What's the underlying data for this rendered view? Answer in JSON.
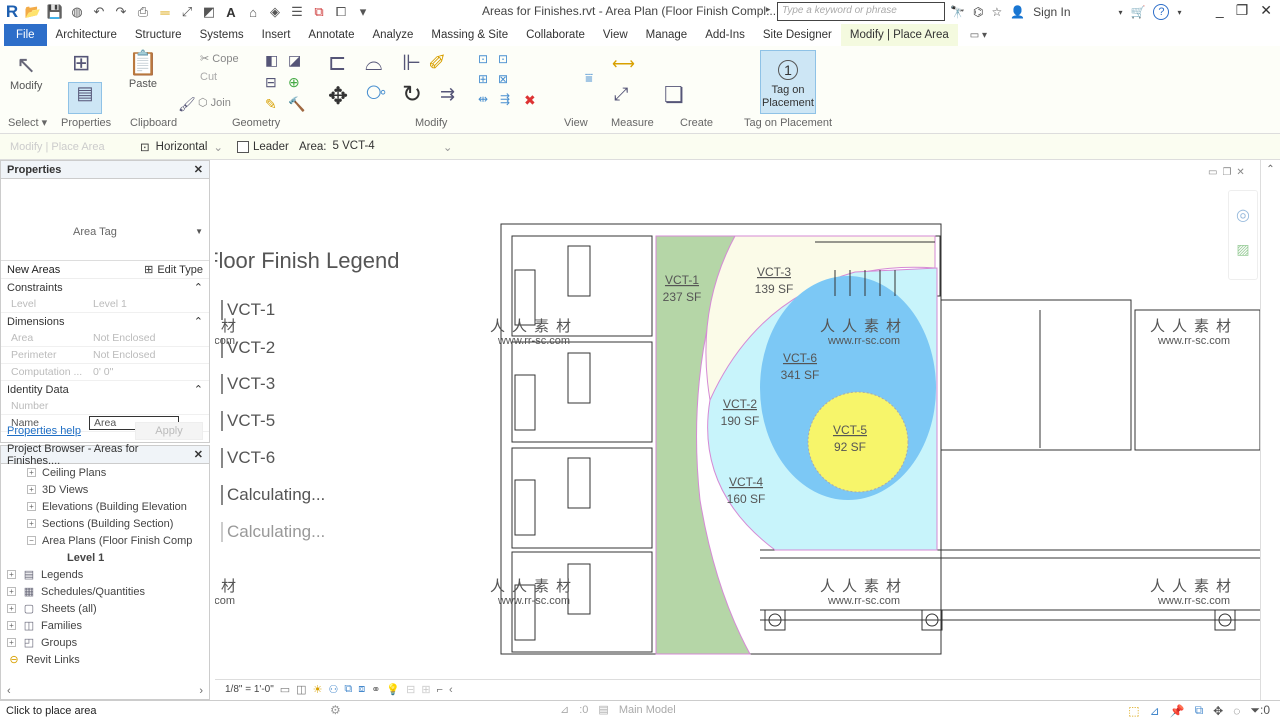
{
  "window": {
    "title": "Areas for Finishes.rvt - Area Plan (Floor Finish Compl...",
    "search_placeholder": "Type a keyword or phrase",
    "sign_in": "Sign In",
    "qat_icons": [
      "revit-logo-icon",
      "open-icon",
      "save-icon",
      "sync-icon",
      "undo-icon",
      "redo-icon",
      "print-icon",
      "measure-icon",
      "dimension-icon",
      "tag-icon",
      "text-icon",
      "3d-view-icon",
      "section-icon",
      "thin-lines-icon",
      "close-hidden-icon",
      "switch-windows-icon",
      "customize-icon"
    ]
  },
  "ribbon_tabs": [
    "File",
    "Architecture",
    "Structure",
    "Systems",
    "Insert",
    "Annotate",
    "Analyze",
    "Massing & Site",
    "Collaborate",
    "View",
    "Manage",
    "Add-Ins",
    "Site Designer",
    "Modify | Place Area"
  ],
  "ribbon": {
    "groups": [
      {
        "label": "Select",
        "dropdown": true
      },
      {
        "label": "Properties"
      },
      {
        "label": "Clipboard"
      },
      {
        "label": "Geometry"
      },
      {
        "label": "Modify"
      },
      {
        "label": "View"
      },
      {
        "label": "Measure"
      },
      {
        "label": "Create"
      },
      {
        "label": "Tag on Placement"
      }
    ],
    "buttons": {
      "modify": "Modify",
      "paste": "Paste",
      "cope": "Cope",
      "cut": "Cut",
      "join": "Join",
      "tag_on_placement_line1": "Tag on",
      "tag_on_placement_line2": "Placement",
      "tag_number": "1"
    }
  },
  "options_bar": {
    "context": "Modify | Place Area",
    "orientation": "Horizontal",
    "leader_label": "Leader",
    "leader_checked": false,
    "area_label": "Area:",
    "area_value": "5  VCT-4"
  },
  "properties": {
    "title": "Properties",
    "type_name": "Area Tag",
    "instance_filter": "New Areas",
    "edit_type": "Edit Type",
    "categories": [
      {
        "name": "Constraints",
        "rows": [
          {
            "key": "Level",
            "value": "Level 1"
          }
        ]
      },
      {
        "name": "Dimensions",
        "rows": [
          {
            "key": "Area",
            "value": "Not Enclosed"
          },
          {
            "key": "Perimeter",
            "value": "Not Enclosed"
          },
          {
            "key": "Computation ...",
            "value": "0' 0\""
          }
        ]
      },
      {
        "name": "Identity Data",
        "rows": [
          {
            "key": "Number",
            "value": ""
          },
          {
            "key": "Name",
            "value": "Area"
          }
        ]
      }
    ],
    "help_link": "Properties help",
    "apply": "Apply"
  },
  "project_browser": {
    "title": "Project Browser - Areas for Finishes....",
    "items": [
      {
        "label": "Ceiling Plans",
        "level": 1,
        "expander": "+",
        "icon": ""
      },
      {
        "label": "3D Views",
        "level": 1,
        "expander": "+",
        "icon": ""
      },
      {
        "label": "Elevations (Building Elevation",
        "level": 1,
        "expander": "+",
        "icon": ""
      },
      {
        "label": "Sections (Building Section)",
        "level": 1,
        "expander": "+",
        "icon": ""
      },
      {
        "label": "Area Plans (Floor Finish Comp",
        "level": 1,
        "expander": "−",
        "icon": ""
      },
      {
        "label": "Level 1",
        "level": 2,
        "expander": "",
        "icon": "",
        "bold": true
      },
      {
        "label": "Legends",
        "level": 0,
        "expander": "+",
        "icon": "▤"
      },
      {
        "label": "Schedules/Quantities",
        "level": 0,
        "expander": "+",
        "icon": "▦"
      },
      {
        "label": "Sheets (all)",
        "level": 0,
        "expander": "+",
        "icon": "▢"
      },
      {
        "label": "Families",
        "level": 0,
        "expander": "+",
        "icon": "◫"
      },
      {
        "label": "Groups",
        "level": 0,
        "expander": "+",
        "icon": "◰"
      },
      {
        "label": "Revit Links",
        "level": 0,
        "expander": "",
        "icon": "⊖"
      }
    ]
  },
  "legend": {
    "title": "Floor Finish Legend",
    "items": [
      "VCT-1",
      "VCT-2",
      "VCT-3",
      "VCT-5",
      "VCT-6",
      "Calculating...",
      "Calculating..."
    ]
  },
  "areas": [
    {
      "name": "VCT-1",
      "area": "237 SF",
      "color": "#b5d6a7"
    },
    {
      "name": "VCT-3",
      "area": "139 SF",
      "color": "#fbfbe8"
    },
    {
      "name": "VCT-6",
      "area": "341 SF",
      "color": "#7cc8f5"
    },
    {
      "name": "VCT-2",
      "area": "190 SF",
      "color": "#c8f4fb"
    },
    {
      "name": "VCT-5",
      "area": "92 SF",
      "color": "#f7f56a"
    },
    {
      "name": "VCT-4",
      "area": "160 SF",
      "color": "#ffffff"
    }
  ],
  "view_control": {
    "scale": "1/8\" = 1'-0\""
  },
  "status": {
    "prompt": "Click to place area",
    "workset_count": ":0",
    "model": "Main Model",
    "filter_count": ":0"
  },
  "watermark": {
    "cn": "人人素材",
    "url": "www.rr-sc.com"
  }
}
